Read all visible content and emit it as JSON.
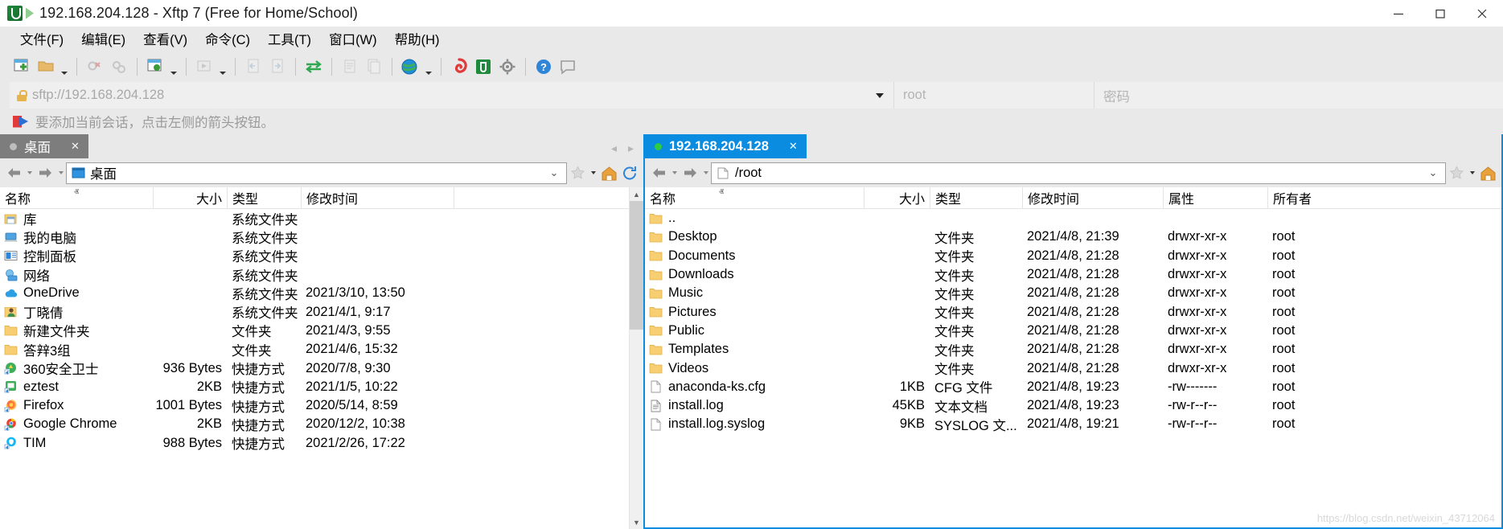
{
  "window": {
    "title": "192.168.204.128 - Xftp 7 (Free for Home/School)",
    "app_icon": "xftp-icon",
    "minimize_label": "─",
    "maximize_label": "☐",
    "close_label": "✕"
  },
  "menu": {
    "items": [
      {
        "label": "文件(F)",
        "name": "menu-file"
      },
      {
        "label": "编辑(E)",
        "name": "menu-edit"
      },
      {
        "label": "查看(V)",
        "name": "menu-view"
      },
      {
        "label": "命令(C)",
        "name": "menu-command"
      },
      {
        "label": "工具(T)",
        "name": "menu-tools"
      },
      {
        "label": "窗口(W)",
        "name": "menu-window"
      },
      {
        "label": "帮助(H)",
        "name": "menu-help"
      }
    ]
  },
  "toolbar": {
    "items": [
      "new-session-icon",
      "open-folder-icon",
      "open-folder-caret",
      "sep",
      "disconnect-icon",
      "connect-icon",
      "sep",
      "session-properties-icon",
      "session-properties-caret",
      "sep",
      "run-icon",
      "run-caret",
      "sep",
      "copy-left-icon",
      "copy-right-icon",
      "sep",
      "transfer-icon",
      "sep",
      "paste-icon",
      "duplicate-icon",
      "sep",
      "browser-icon",
      "browser-caret",
      "sep",
      "xshell-icon",
      "xftp-icon",
      "settings-icon",
      "sep",
      "help-icon",
      "feedback-icon"
    ]
  },
  "connection": {
    "url": "sftp://192.168.204.128",
    "lock_icon": "lock-icon",
    "dropdown_icon": "chevron-down-icon",
    "username_placeholder": "root",
    "password_placeholder": "密码"
  },
  "hint": {
    "icon": "add-session-arrow-icon",
    "text": "要添加当前会话，点击左侧的箭头按钮。"
  },
  "left_pane": {
    "tab": {
      "label": "桌面",
      "close": "✕",
      "status_dot": "status-dot-idle"
    },
    "path": {
      "value": "桌面",
      "icon": "desktop-icon",
      "chevron": "⌄"
    },
    "nav": {
      "back": "←",
      "forward": "→",
      "up": "home-icon",
      "refresh": "refresh-icon",
      "star": "star-icon"
    },
    "columns": [
      {
        "label": "名称",
        "align": "left"
      },
      {
        "label": "大小",
        "align": "right"
      },
      {
        "label": "类型",
        "align": "left"
      },
      {
        "label": "修改时间",
        "align": "left"
      },
      {
        "label": "",
        "align": "left"
      }
    ],
    "sort_indicator": "ⱏ",
    "rows": [
      {
        "icon": "library-icon",
        "name": "库",
        "size": "",
        "type": "系统文件夹",
        "time": ""
      },
      {
        "icon": "computer-icon",
        "name": "我的电脑",
        "size": "",
        "type": "系统文件夹",
        "time": ""
      },
      {
        "icon": "control-panel-icon",
        "name": "控制面板",
        "size": "",
        "type": "系统文件夹",
        "time": ""
      },
      {
        "icon": "network-icon",
        "name": "网络",
        "size": "",
        "type": "系统文件夹",
        "time": ""
      },
      {
        "icon": "onedrive-icon",
        "name": "OneDrive",
        "size": "",
        "type": "系统文件夹",
        "time": "2021/3/10, 13:50"
      },
      {
        "icon": "user-icon",
        "name": "丁晓倩",
        "size": "",
        "type": "系统文件夹",
        "time": "2021/4/1, 9:17"
      },
      {
        "icon": "folder-icon",
        "name": "新建文件夹",
        "size": "",
        "type": "文件夹",
        "time": "2021/4/3, 9:55"
      },
      {
        "icon": "folder-icon",
        "name": "答辡3组",
        "size": "",
        "type": "文件夹",
        "time": "2021/4/6, 15:32"
      },
      {
        "icon": "360-icon",
        "name": "360安全卫士",
        "size": "936 Bytes",
        "type": "快捷方式",
        "time": "2020/7/8, 9:30"
      },
      {
        "icon": "eztest-icon",
        "name": "eztest",
        "size": "2KB",
        "type": "快捷方式",
        "time": "2021/1/5, 10:22"
      },
      {
        "icon": "firefox-icon",
        "name": "Firefox",
        "size": "1001 Bytes",
        "type": "快捷方式",
        "time": "2020/5/14, 8:59"
      },
      {
        "icon": "chrome-icon",
        "name": "Google Chrome",
        "size": "2KB",
        "type": "快捷方式",
        "time": "2020/12/2, 10:38"
      },
      {
        "icon": "tim-icon",
        "name": "TIM",
        "size": "988 Bytes",
        "type": "快捷方式",
        "time": "2021/2/26, 17:22"
      }
    ]
  },
  "right_pane": {
    "tab": {
      "label": "192.168.204.128",
      "close": "✕",
      "status_dot": "status-dot-connected"
    },
    "path": {
      "value": "/root",
      "icon": "file-icon",
      "chevron": "⌄"
    },
    "nav": {
      "back": "←",
      "forward": "→",
      "up": "home-icon",
      "refresh": "refresh-icon",
      "star": "star-icon"
    },
    "columns": [
      {
        "label": "名称",
        "align": "left"
      },
      {
        "label": "大小",
        "align": "right"
      },
      {
        "label": "类型",
        "align": "left"
      },
      {
        "label": "修改时间",
        "align": "left"
      },
      {
        "label": "属性",
        "align": "left"
      },
      {
        "label": "所有者",
        "align": "left"
      }
    ],
    "sort_indicator": "ⱏ",
    "rows": [
      {
        "icon": "folder-icon",
        "name": "..",
        "size": "",
        "type": "",
        "time": "",
        "attr": "",
        "owner": ""
      },
      {
        "icon": "folder-icon",
        "name": "Desktop",
        "size": "",
        "type": "文件夹",
        "time": "2021/4/8, 21:39",
        "attr": "drwxr-xr-x",
        "owner": "root"
      },
      {
        "icon": "folder-icon",
        "name": "Documents",
        "size": "",
        "type": "文件夹",
        "time": "2021/4/8, 21:28",
        "attr": "drwxr-xr-x",
        "owner": "root"
      },
      {
        "icon": "folder-icon",
        "name": "Downloads",
        "size": "",
        "type": "文件夹",
        "time": "2021/4/8, 21:28",
        "attr": "drwxr-xr-x",
        "owner": "root"
      },
      {
        "icon": "folder-icon",
        "name": "Music",
        "size": "",
        "type": "文件夹",
        "time": "2021/4/8, 21:28",
        "attr": "drwxr-xr-x",
        "owner": "root"
      },
      {
        "icon": "folder-icon",
        "name": "Pictures",
        "size": "",
        "type": "文件夹",
        "time": "2021/4/8, 21:28",
        "attr": "drwxr-xr-x",
        "owner": "root"
      },
      {
        "icon": "folder-icon",
        "name": "Public",
        "size": "",
        "type": "文件夹",
        "time": "2021/4/8, 21:28",
        "attr": "drwxr-xr-x",
        "owner": "root"
      },
      {
        "icon": "folder-icon",
        "name": "Templates",
        "size": "",
        "type": "文件夹",
        "time": "2021/4/8, 21:28",
        "attr": "drwxr-xr-x",
        "owner": "root"
      },
      {
        "icon": "folder-icon",
        "name": "Videos",
        "size": "",
        "type": "文件夹",
        "time": "2021/4/8, 21:28",
        "attr": "drwxr-xr-x",
        "owner": "root"
      },
      {
        "icon": "file-icon",
        "name": "anaconda-ks.cfg",
        "size": "1KB",
        "type": "CFG 文件",
        "time": "2021/4/8, 19:23",
        "attr": "-rw-------",
        "owner": "root"
      },
      {
        "icon": "text-file-icon",
        "name": "install.log",
        "size": "45KB",
        "type": "文本文档",
        "time": "2021/4/8, 19:23",
        "attr": "-rw-r--r--",
        "owner": "root"
      },
      {
        "icon": "file-icon",
        "name": "install.log.syslog",
        "size": "9KB",
        "type": "SYSLOG 文...",
        "time": "2021/4/8, 19:21",
        "attr": "-rw-r--r--",
        "owner": "root"
      }
    ],
    "watermark": "https://blog.csdn.net/weixin_43712064"
  },
  "colors": {
    "accent": "#0a8ce0",
    "tab_inactive": "#7d7d7d",
    "chrome": "#e9e9e9",
    "status_connected": "#2ecc40"
  }
}
